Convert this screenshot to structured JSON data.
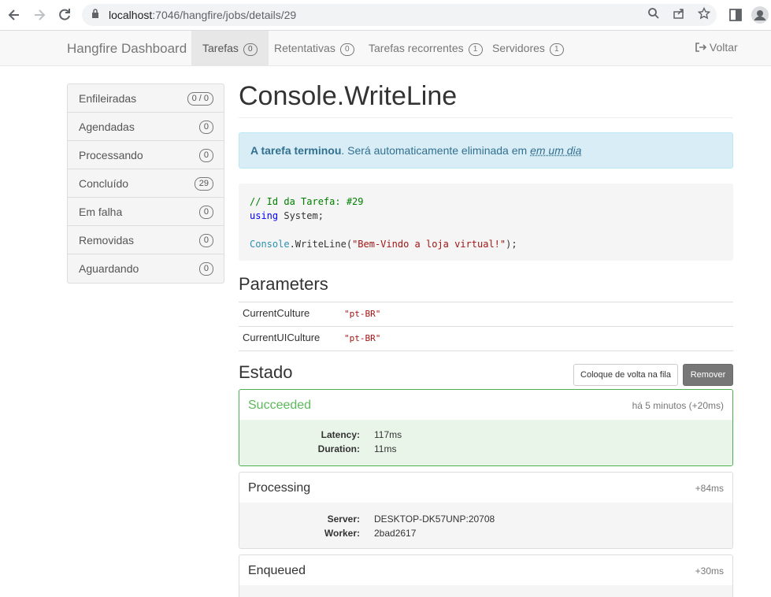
{
  "browser": {
    "url_host": "localhost",
    "url_rest": ":7046/hangfire/jobs/details/29"
  },
  "navbar": {
    "brand": "Hangfire Dashboard",
    "items": [
      {
        "label": "Tarefas",
        "count": "0"
      },
      {
        "label": "Retentativas",
        "count": "0"
      },
      {
        "label": "Tarefas recorrentes",
        "count": "1"
      },
      {
        "label": "Servidores",
        "count": "1"
      }
    ],
    "back_label": "Voltar"
  },
  "sidebar": {
    "items": [
      {
        "label": "Enfileiradas",
        "count": "0 / 0"
      },
      {
        "label": "Agendadas",
        "count": "0"
      },
      {
        "label": "Processando",
        "count": "0"
      },
      {
        "label": "Concluído",
        "count": "29"
      },
      {
        "label": "Em falha",
        "count": "0"
      },
      {
        "label": "Removidas",
        "count": "0"
      },
      {
        "label": "Aguardando",
        "count": "0"
      }
    ]
  },
  "job": {
    "title": "Console.WriteLine",
    "alert_strong": "A tarefa terminou",
    "alert_text": ". Será automaticamente eliminada em ",
    "alert_time": "em um dia",
    "code": {
      "comment": "// Id da Tarefa: #29",
      "using_kw": "using",
      "using_rest": " System;",
      "call_cls": "Console",
      "call_method": ".WriteLine(",
      "call_str": "\"Bem-Vindo a loja virtual!\"",
      "call_end": ");"
    }
  },
  "parameters": {
    "heading": "Parameters",
    "rows": [
      {
        "key": "CurrentCulture",
        "value": "\"pt-BR\""
      },
      {
        "key": "CurrentUICulture",
        "value": "\"pt-BR\""
      }
    ]
  },
  "states": {
    "heading": "Estado",
    "requeue_label": "Coloque de volta na fila",
    "delete_label": "Remover",
    "items": [
      {
        "name": "Succeeded",
        "time": "há 5 minutos (+20ms)",
        "rows": [
          {
            "k": "Latency:",
            "v": "117ms"
          },
          {
            "k": "Duration:",
            "v": "11ms"
          }
        ]
      },
      {
        "name": "Processing",
        "time": "+84ms",
        "rows": [
          {
            "k": "Server:",
            "v": "DESKTOP-DK57UNP:20708"
          },
          {
            "k": "Worker:",
            "v": "2bad2617"
          }
        ]
      },
      {
        "name": "Enqueued",
        "time": "+30ms",
        "rows": []
      }
    ]
  },
  "colors": {
    "success": "#5cb85c",
    "info_bg": "#d9edf7",
    "info_text": "#31708f"
  }
}
